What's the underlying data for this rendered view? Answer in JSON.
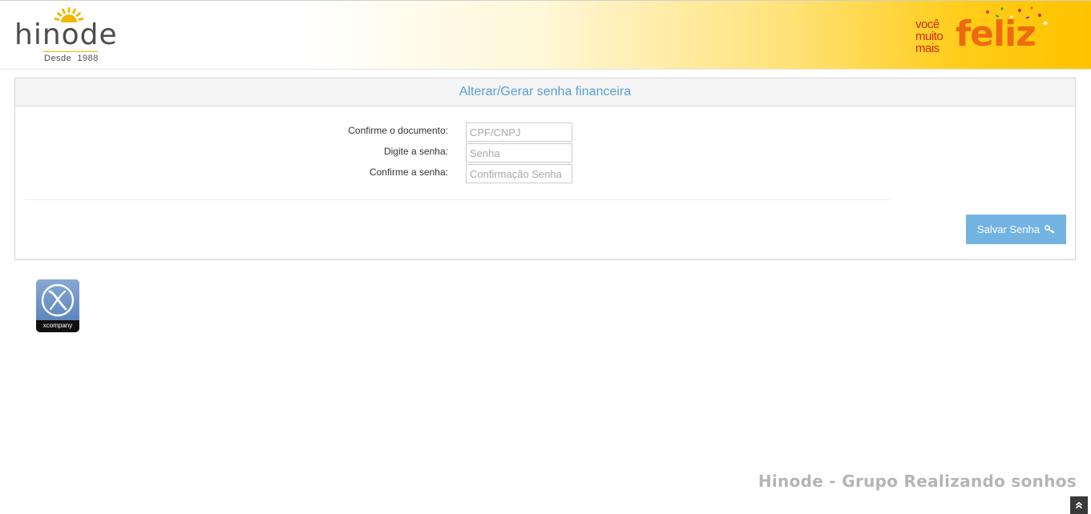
{
  "header": {
    "logo": {
      "brand": "hinode",
      "since": "Desde  1988"
    },
    "slogan": {
      "line1": "você",
      "line2": "muito",
      "line3": "mais",
      "big": "feliz"
    }
  },
  "panel": {
    "title": "Alterar/Gerar senha financeira",
    "fields": [
      {
        "label": "Confirme o documento:",
        "placeholder": "CPF/CNPJ",
        "value": ""
      },
      {
        "label": "Digite a senha:",
        "placeholder": "Senha",
        "value": ""
      },
      {
        "label": "Confirme a senha:",
        "placeholder": "Confirmação Senha",
        "value": ""
      }
    ],
    "save_label": "Salvar Senha",
    "save_icon": "key-icon"
  },
  "xcompany": {
    "label": "xcompany"
  },
  "footer": {
    "text": "Hinode - Grupo Realizando sonhos",
    "scroll_icon": "double-chevron-up-icon"
  },
  "colors": {
    "accent_blue": "#5a9ed0",
    "button_blue": "#73b3e2",
    "brand_yellow": "#ffc300",
    "slogan_red": "#d6290a",
    "slogan_orange": "#ee6a10"
  }
}
